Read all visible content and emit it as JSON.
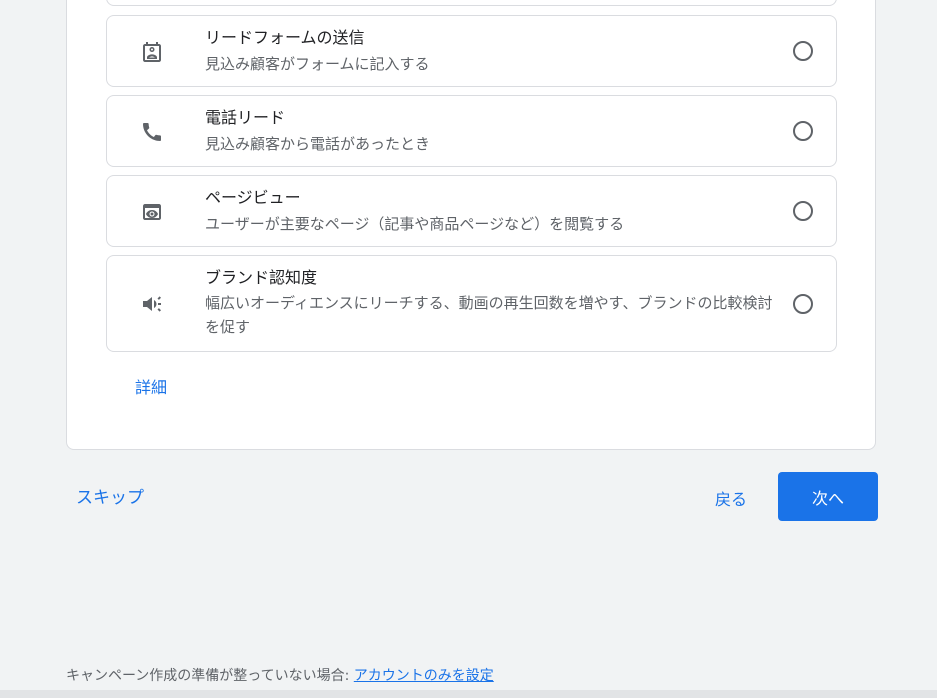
{
  "options": [
    {
      "icon": "contact-form-icon",
      "title": "リードフォームの送信",
      "description": "見込み顧客がフォームに記入する"
    },
    {
      "icon": "phone-icon",
      "title": "電話リード",
      "description": "見込み顧客から電話があったとき"
    },
    {
      "icon": "page-view-icon",
      "title": "ページビュー",
      "description": "ユーザーが主要なページ（記事や商品ページなど）を閲覧する"
    },
    {
      "icon": "megaphone-icon",
      "title": "ブランド認知度",
      "description": "幅広いオーディエンスにリーチする、動画の再生回数を増やす、ブランドの比較検討を促す"
    }
  ],
  "details_link": "詳細",
  "nav": {
    "skip": "スキップ",
    "back": "戻る",
    "next": "次へ"
  },
  "footer": {
    "text": "キャンペーン作成の準備が整っていない場合: ",
    "link": "アカウントのみを設定"
  },
  "colors": {
    "accent": "#1a73e8",
    "background": "#f1f3f4",
    "border": "#dadce0"
  }
}
